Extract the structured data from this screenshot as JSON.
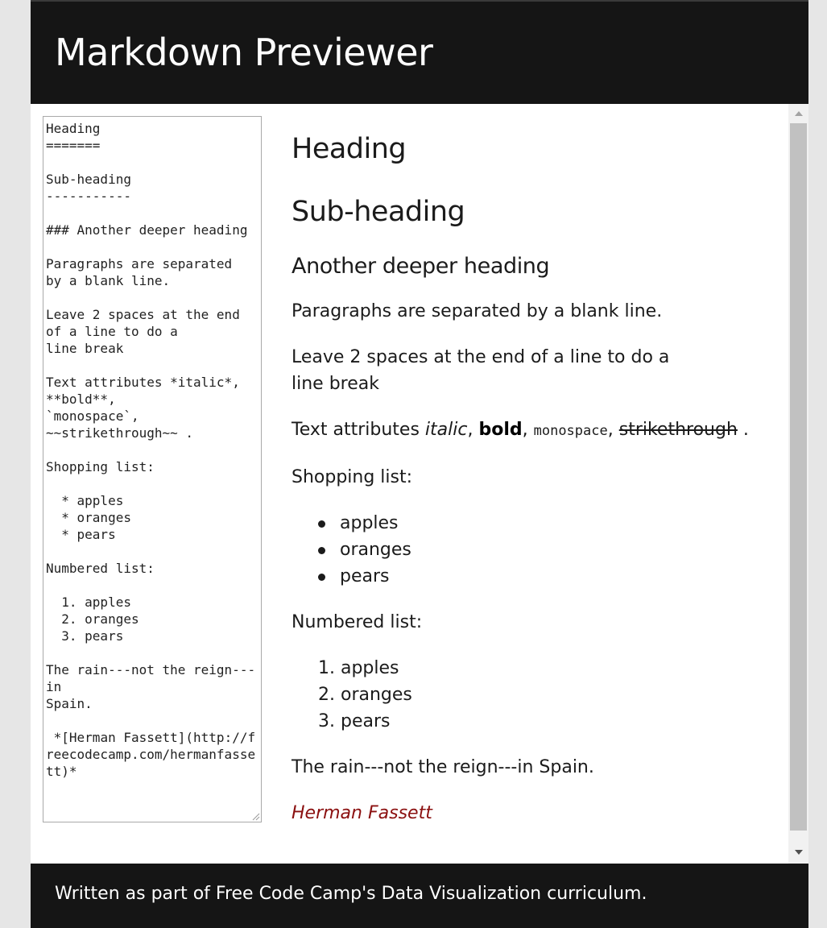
{
  "header": {
    "title": "Markdown Previewer"
  },
  "editor": {
    "text": "Heading\n=======\n\nSub-heading\n-----------\n\n### Another deeper heading\n\nParagraphs are separated\nby a blank line.\n\nLeave 2 spaces at the end\nof a line to do a\nline break\n\nText attributes *italic*,\n**bold**,\n`monospace`,\n~~strikethrough~~ .\n\nShopping list:\n\n  * apples\n  * oranges\n  * pears\n\nNumbered list:\n\n  1. apples\n  2. oranges\n  3. pears\n\nThe rain---not the reign---in\nSpain.\n\n *[Herman Fassett](http://freecodecamp.com/hermanfassett)*"
  },
  "preview": {
    "h1": "Heading",
    "h2": "Sub-heading",
    "h3": "Another deeper heading",
    "p1": "Paragraphs are separated by a blank line.",
    "p2_line1": "Leave 2 spaces at the end of a line to do a",
    "p2_line2": "line break",
    "attrs": {
      "prefix": "Text attributes ",
      "italic": "italic",
      "bold": "bold",
      "monospace": "monospace",
      "strike": "strikethrough",
      "sep": ", ",
      "end": " ."
    },
    "shopping_label": "Shopping list:",
    "shopping_items": [
      "apples",
      "oranges",
      "pears"
    ],
    "numbered_label": "Numbered list:",
    "numbered_items": [
      "1. apples",
      "2. oranges",
      "3. pears"
    ],
    "rain": "The rain---not the reign---in Spain.",
    "link_text": "Herman Fassett"
  },
  "footer": {
    "text": "Written as part of Free Code Camp's Data Visualization curriculum."
  },
  "colors": {
    "bar": "#151515",
    "link": "#8b1010",
    "scroll_thumb": "#c1c1c1"
  }
}
